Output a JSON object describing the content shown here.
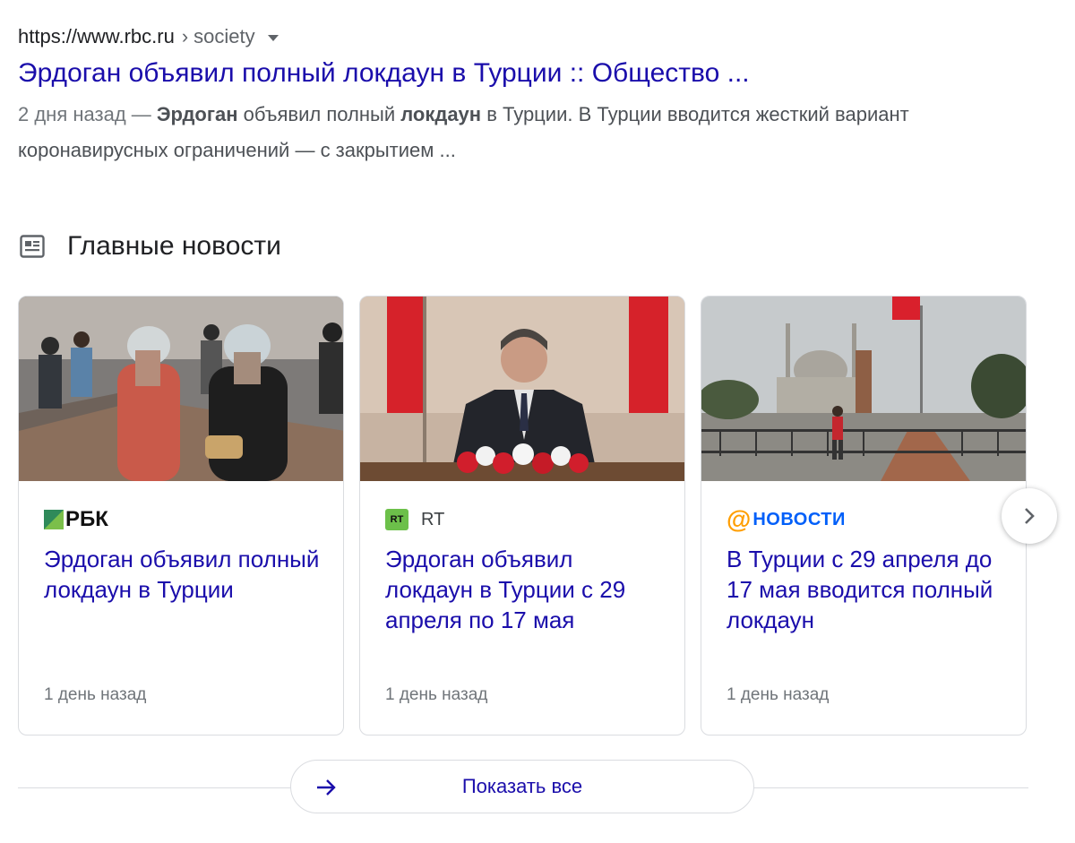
{
  "result": {
    "url": "https://www.rbc.ru",
    "breadcrumb_sep": "›",
    "path": "society",
    "title": "Эрдоган объявил полный локдаун в Турции :: Общество ...",
    "snippet": {
      "date": "2 дня назад —",
      "parts": [
        "Эрдоган",
        " объявил полный ",
        "локдаун",
        " в Турции. В Турции вводится жесткий вариант коронавирусных ограничений — с закрытием ..."
      ]
    }
  },
  "top_news": {
    "heading": "Главные новости",
    "cards": [
      {
        "source": "РБК",
        "headline": "Эрдоган объявил полный локдаун в Турции",
        "time": "1 день назад"
      },
      {
        "source": "RT",
        "source_logo_text": "RT",
        "headline": "Эрдоган объявил локдаун в Турции с 29 апреля по 17 мая",
        "time": "1 день назад"
      },
      {
        "source": "новости",
        "headline": "В Турции с 29 апреля до 17 мая вводится полный локдаун",
        "time": "1 день назад"
      }
    ],
    "show_all": "Показать все"
  },
  "colors": {
    "link": "#1a0dab",
    "text": "#202124",
    "muted": "#70757a",
    "rbk_green": "#2f8a5a",
    "rt_green": "#6cc04a",
    "mail_orange": "#ff9e00",
    "mail_blue": "#005ff9",
    "turkish_red": "#e30a17"
  },
  "icons": {
    "section": "newspaper-icon",
    "next": "chevron-right-icon",
    "show_all": "arrow-right-icon",
    "url_menu": "caret-down-icon"
  }
}
